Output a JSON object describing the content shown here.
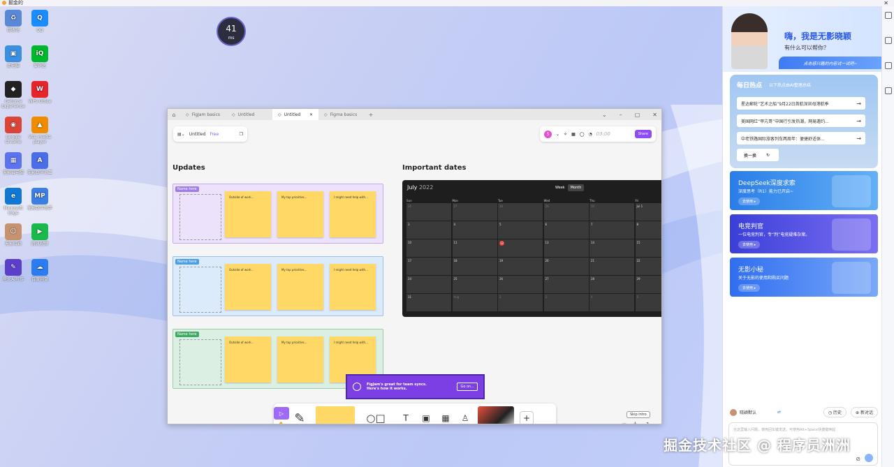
{
  "taskbar": {
    "app_name": "掘金的"
  },
  "desktop": {
    "icons": [
      {
        "label": "回收站",
        "color": "#5a88d8",
        "glyph": "♻"
      },
      {
        "label": "QQ",
        "color": "#1a8cff",
        "glyph": "Q"
      },
      {
        "label": "此电脑",
        "color": "#3b8fe0",
        "glyph": "▣"
      },
      {
        "label": "爱奇艺",
        "color": "#00b82b",
        "glyph": "iQ"
      },
      {
        "label": "GeForce Experience",
        "color": "#222",
        "glyph": "◆"
      },
      {
        "label": "WPS Office",
        "color": "#e6242a",
        "glyph": "W"
      },
      {
        "label": "Google Chrome",
        "color": "#db4437",
        "glyph": "◉"
      },
      {
        "label": "VLC media player",
        "color": "#f08c00",
        "glyph": "▲"
      },
      {
        "label": "无影云电脑",
        "color": "#5b73ee",
        "glyph": "▦"
      },
      {
        "label": "无影数字员工",
        "color": "#4a6de8",
        "glyph": "A"
      },
      {
        "label": "Microsoft Edge",
        "color": "#0f78d4",
        "glyph": "e"
      },
      {
        "label": "无影数字助手",
        "color": "#3a7ee6",
        "glyph": "MP"
      },
      {
        "label": "无影晓颖",
        "color": "#c7926f",
        "glyph": "☺"
      },
      {
        "label": "腾讯视频",
        "color": "#19b94c",
        "glyph": "▶"
      },
      {
        "label": "星火AI写作",
        "color": "#5b3ec9",
        "glyph": "✎"
      },
      {
        "label": "百度网盘",
        "color": "#2b7cf0",
        "glyph": "☁"
      }
    ]
  },
  "latency": {
    "value": "41",
    "unit": "ms"
  },
  "figjam": {
    "tabs": [
      {
        "label": "FigJam basics",
        "active": false
      },
      {
        "label": "Untitled",
        "active": false
      },
      {
        "label": "Untitled",
        "active": true
      },
      {
        "label": "Figma basics",
        "active": false
      }
    ],
    "file_name": "Untitled",
    "plan": "Free",
    "avatar_letter": "S",
    "timer": "03:00",
    "share_label": "Share",
    "updates_heading": "Updates",
    "dates_heading": "Important dates",
    "sections": [
      {
        "name": "Name here",
        "bg": "#ece2fb",
        "border": "#c7a9f2",
        "tag": "#a07ce8"
      },
      {
        "name": "Name here",
        "bg": "#dcebfb",
        "border": "#95c2ef",
        "tag": "#4a9ee8"
      },
      {
        "name": "Name here",
        "bg": "#dcefe3",
        "border": "#97cfa9",
        "tag": "#3eaa63"
      }
    ],
    "stickies": [
      "Outside of work...",
      "My top priorities...",
      "I might need help with..."
    ],
    "calendar": {
      "month": "July",
      "year": "2022",
      "toggle": [
        "Week",
        "Month"
      ],
      "days": [
        "Sun",
        "Mon",
        "Tue",
        "Wed",
        "Thu",
        "Fri"
      ],
      "weeks": [
        [
          "26",
          "27",
          "28",
          "29",
          "30",
          "Jul 1"
        ],
        [
          "3",
          "4",
          "5",
          "6",
          "7",
          "8"
        ],
        [
          "10",
          "11",
          "12",
          "13",
          "14",
          "15"
        ],
        [
          "17",
          "18",
          "19",
          "20",
          "21",
          "22"
        ],
        [
          "24",
          "25",
          "26",
          "27",
          "28",
          "29"
        ],
        [
          "31",
          "Aug",
          "2",
          "3",
          "4",
          "5"
        ]
      ]
    },
    "banner": {
      "line1": "FigJam's great for team syncs.",
      "line2": "Here's how it works.",
      "button": "Go on..."
    },
    "skip_intro": "Skip intro"
  },
  "assistant": {
    "greeting": "嗨，我是无影晓颖",
    "question": "有什么可以帮你？",
    "strip": "点击感兴趣的内容试一试吧~",
    "hot": {
      "title": "每日热点",
      "subtitle": "以下热点由AI整理总结",
      "items": [
        "星达郵轮“艺术之船”9月22日首航深圳母港航季",
        "美国网红“甲亢哥”中国行引发热潮，网易邀约...",
        "中老铁路国际旅客列车两周年：便捷舒适体..."
      ],
      "refresh": "换一换"
    },
    "cards": [
      {
        "title": "DeepSeek深度求索",
        "sub": "深度思考（R1）能力已开启~",
        "btn": "去使用",
        "from": "#2a7de8",
        "to": "#63b0f7"
      },
      {
        "title": "电竞判官",
        "sub": "一位电竞判官，专“判”电竞疑难杂案。",
        "btn": "去使用",
        "from": "#3a3fd8",
        "to": "#7b6ef2"
      },
      {
        "title": "无影小秘",
        "sub": "关于无影的使用和购买问题",
        "btn": "去使用",
        "from": "#2f6ef0",
        "to": "#79a8f8"
      }
    ],
    "model": "晓颖默认",
    "history": "历史",
    "new_chat": "新对话",
    "input_placeholder": "在这里输入问题，使用回车键发送，可使用Alt+Space快捷键唤起"
  },
  "watermark": "掘金技术社区 @ 程序员洲洲"
}
